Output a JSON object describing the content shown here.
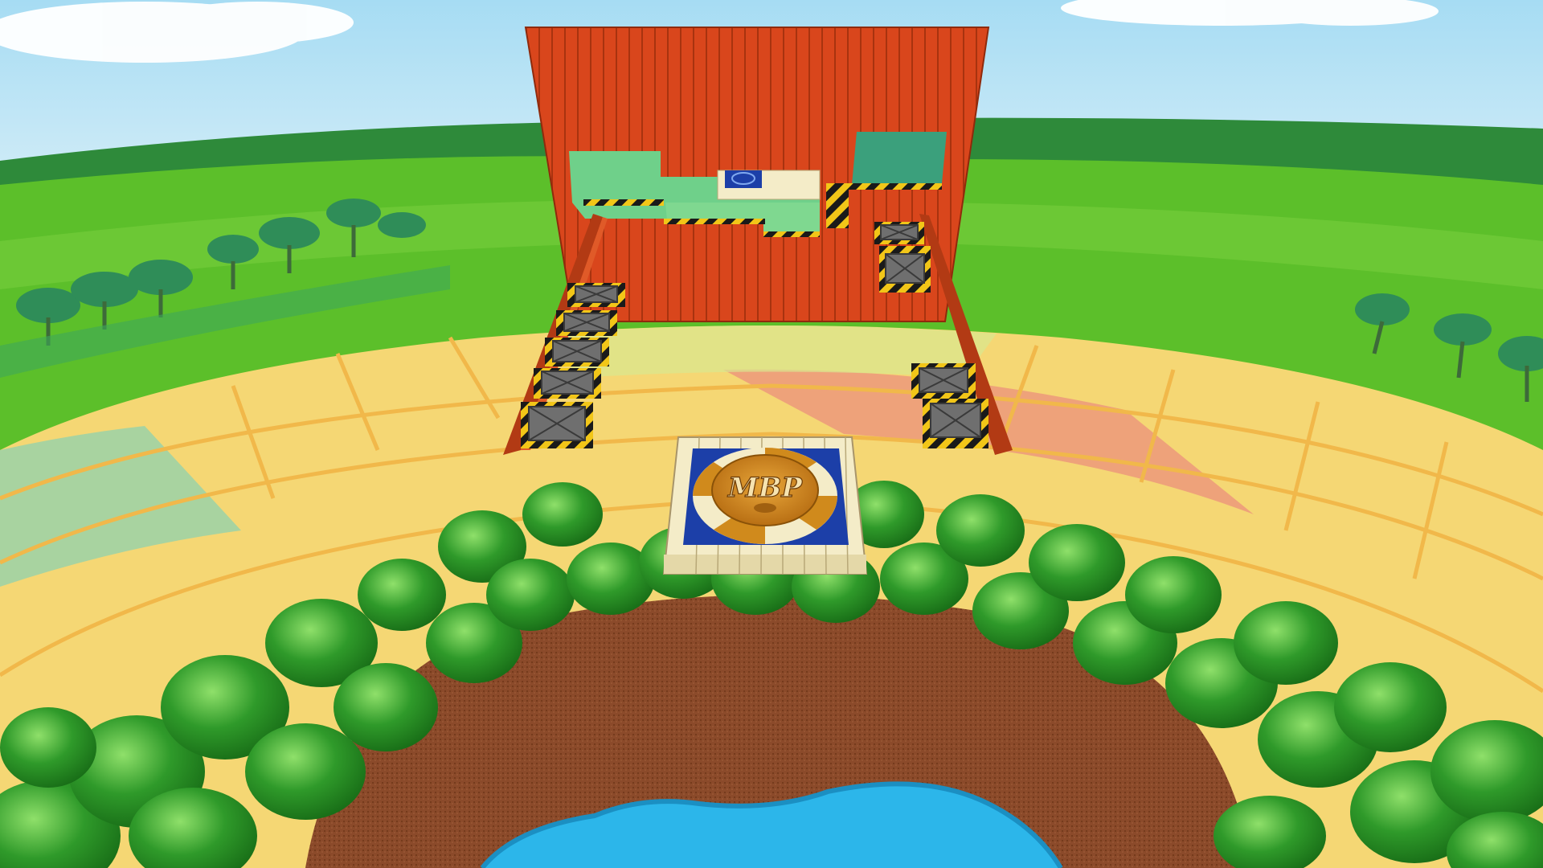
{
  "scene": {
    "title": "",
    "start_pad": {
      "logo_text": "MBP"
    },
    "colors": {
      "sky": "#8fd3f0",
      "wall": "#d9461c",
      "hazard_yellow": "#f2c618",
      "hazard_black": "#1a1a1a",
      "grass": "#5cbf2a",
      "field_yellow": "#f5d774",
      "field_orange": "#eea27a",
      "dirt": "#8b4a2a",
      "water": "#2cb6ea",
      "bush": "#2f9a2a",
      "pad_blue": "#1c3fa8",
      "pad_gold": "#d08a1c",
      "tile_cream": "#f4ecc8"
    },
    "objects": [
      {
        "name": "start-pad",
        "type": "platform"
      },
      {
        "name": "finish-pad",
        "type": "platform"
      },
      {
        "name": "orange-wall",
        "type": "obstacle"
      },
      {
        "name": "crate-ramp-left",
        "count": 5
      },
      {
        "name": "crate-ramp-right",
        "count": 2
      },
      {
        "name": "crate-stack-upper-right",
        "count": 2
      }
    ]
  }
}
